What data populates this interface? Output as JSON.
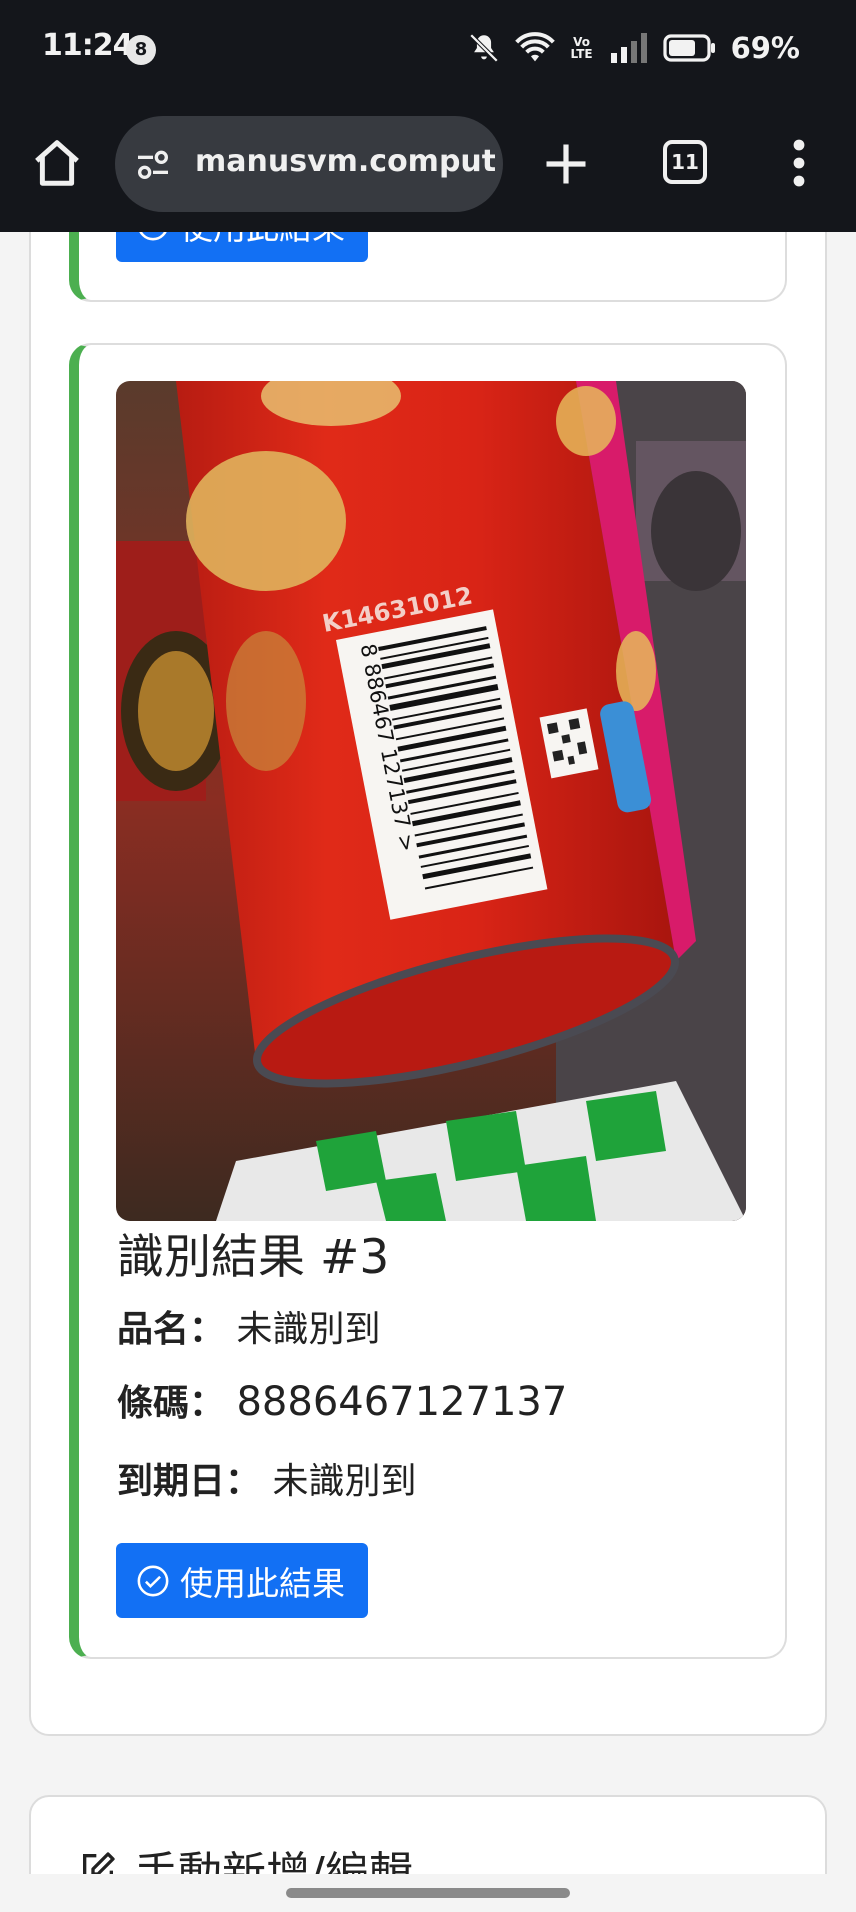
{
  "status_bar": {
    "time": "11:24",
    "notification_badge": "8",
    "battery_percent": "69%",
    "volte_label": "Vo LTE",
    "icons": [
      "mute-icon",
      "wifi-icon",
      "volte-icon",
      "signal-icon",
      "battery-icon"
    ]
  },
  "browser": {
    "url": "manusvm.computer",
    "tab_count": "11",
    "icons": [
      "home-icon",
      "site-settings-icon",
      "plus-icon",
      "tabs-icon",
      "menu-icon"
    ]
  },
  "results": {
    "use_result_label": "使用此結果",
    "current": {
      "title": "識別結果 #3",
      "name_label": "品名：",
      "name_value": "未識別到",
      "barcode_label": "條碼：",
      "barcode_value": "8886467127137",
      "expiry_label": "到期日：",
      "expiry_value": "未識別到",
      "photo": {
        "batch_code": "K14631012",
        "barcode_digits": "8 886467 127137 >"
      }
    }
  },
  "manual_edit": {
    "title": "手動新增/編輯"
  },
  "colors": {
    "accent_green": "#4caf50",
    "button_blue": "#1270f4",
    "browser_dark": "#14161b"
  }
}
